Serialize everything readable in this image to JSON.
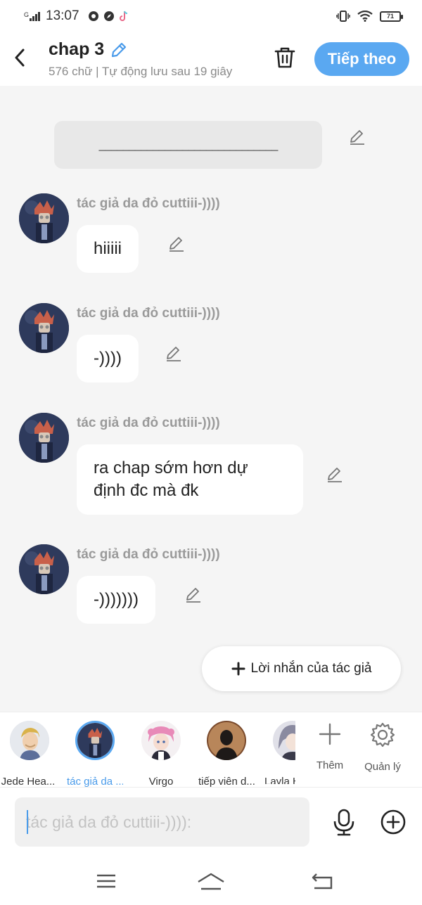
{
  "status_bar": {
    "network": "G",
    "time": "13:07",
    "battery": "71"
  },
  "header": {
    "title": "chap 3",
    "subtitle": "576 chữ | Tự động lưu sau 19 giây",
    "next_label": "Tiếp theo"
  },
  "content": {
    "narration": "______________________________",
    "messages": [
      {
        "character": "tác giả da đỏ cuttiii-))))",
        "text": "hiiiii"
      },
      {
        "character": "tác giả da đỏ cuttiii-))))",
        "text": "-))))"
      },
      {
        "character": "tác giả da đỏ cuttiii-))))",
        "text_line1": "ra chap sớm hơn dự",
        "text_line2": "định đc mà đk"
      },
      {
        "character": "tác giả da đỏ cuttiii-))))",
        "text": "-)))))))"
      }
    ],
    "author_note_label": "Lời nhắn của tác giả"
  },
  "character_bar": {
    "characters": [
      {
        "name": "Jede Hea..."
      },
      {
        "name": "tác giả da ...",
        "active": true
      },
      {
        "name": "Virgo"
      },
      {
        "name": "tiếp viên d..."
      },
      {
        "name": "Layla H"
      }
    ],
    "add_label": "Thêm",
    "manage_label": "Quản lý"
  },
  "input": {
    "placeholder": "tác giả da đỏ cuttiii-)))):"
  },
  "colors": {
    "accent": "#5aa8f1",
    "active_text": "#4a9bea",
    "background": "#f5f5f5"
  },
  "icons": [
    "back-icon",
    "pencil-icon",
    "trash-icon",
    "plus-icon",
    "gear-icon",
    "mic-icon",
    "plus-circle-icon",
    "menu-icon",
    "home-icon",
    "back-nav-icon"
  ]
}
